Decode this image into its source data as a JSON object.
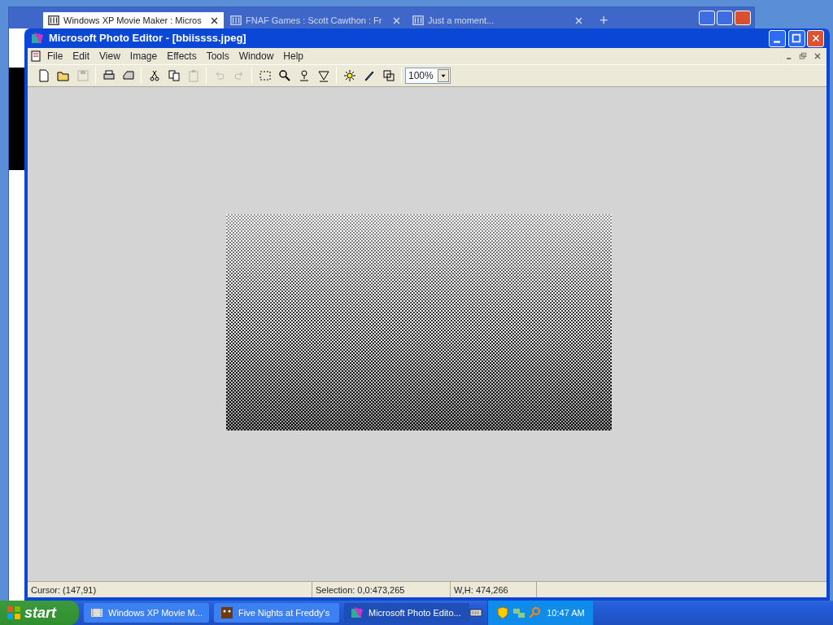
{
  "browser": {
    "tabs": [
      {
        "label": "Windows XP Movie Maker : Micros",
        "selected": true
      },
      {
        "label": "FNAF Games : Scott Cawthon : Fr",
        "selected": false
      },
      {
        "label": "Just a moment...",
        "selected": false
      }
    ],
    "new_tab": "+"
  },
  "window": {
    "title": "Microsoft Photo Editor - [bbiissss.jpeg]"
  },
  "menu": [
    "File",
    "Edit",
    "View",
    "Image",
    "Effects",
    "Tools",
    "Window",
    "Help"
  ],
  "toolbar": {
    "buttons": [
      {
        "kind": "new",
        "disabled": false
      },
      {
        "kind": "open",
        "disabled": false
      },
      {
        "kind": "save",
        "disabled": true
      },
      {
        "kind": "print",
        "disabled": false
      },
      {
        "kind": "scan",
        "disabled": false
      },
      {
        "kind": "cut",
        "disabled": false
      },
      {
        "kind": "copy",
        "disabled": false
      },
      {
        "kind": "paste",
        "disabled": true
      },
      {
        "kind": "undo",
        "disabled": true
      },
      {
        "kind": "redo",
        "disabled": true
      },
      {
        "kind": "select",
        "disabled": false
      },
      {
        "kind": "zoom",
        "disabled": false
      },
      {
        "kind": "stamp",
        "disabled": false
      },
      {
        "kind": "funnel",
        "disabled": false
      },
      {
        "kind": "sun",
        "disabled": false
      },
      {
        "kind": "pen",
        "disabled": false
      },
      {
        "kind": "resize",
        "disabled": false
      }
    ],
    "zoom": "100%"
  },
  "status_bar": [
    "Cursor: (147,91)",
    "Selection: 0,0:473,265",
    "W,H: 474,266"
  ],
  "taskbar": {
    "start": "start",
    "tasks": [
      {
        "label": "Windows XP Movie M...",
        "selected": false
      },
      {
        "label": "Five Nights at Freddy's",
        "selected": false
      },
      {
        "label": "Microsoft Photo Edito...",
        "selected": true
      }
    ],
    "clock": "10:47 AM"
  }
}
